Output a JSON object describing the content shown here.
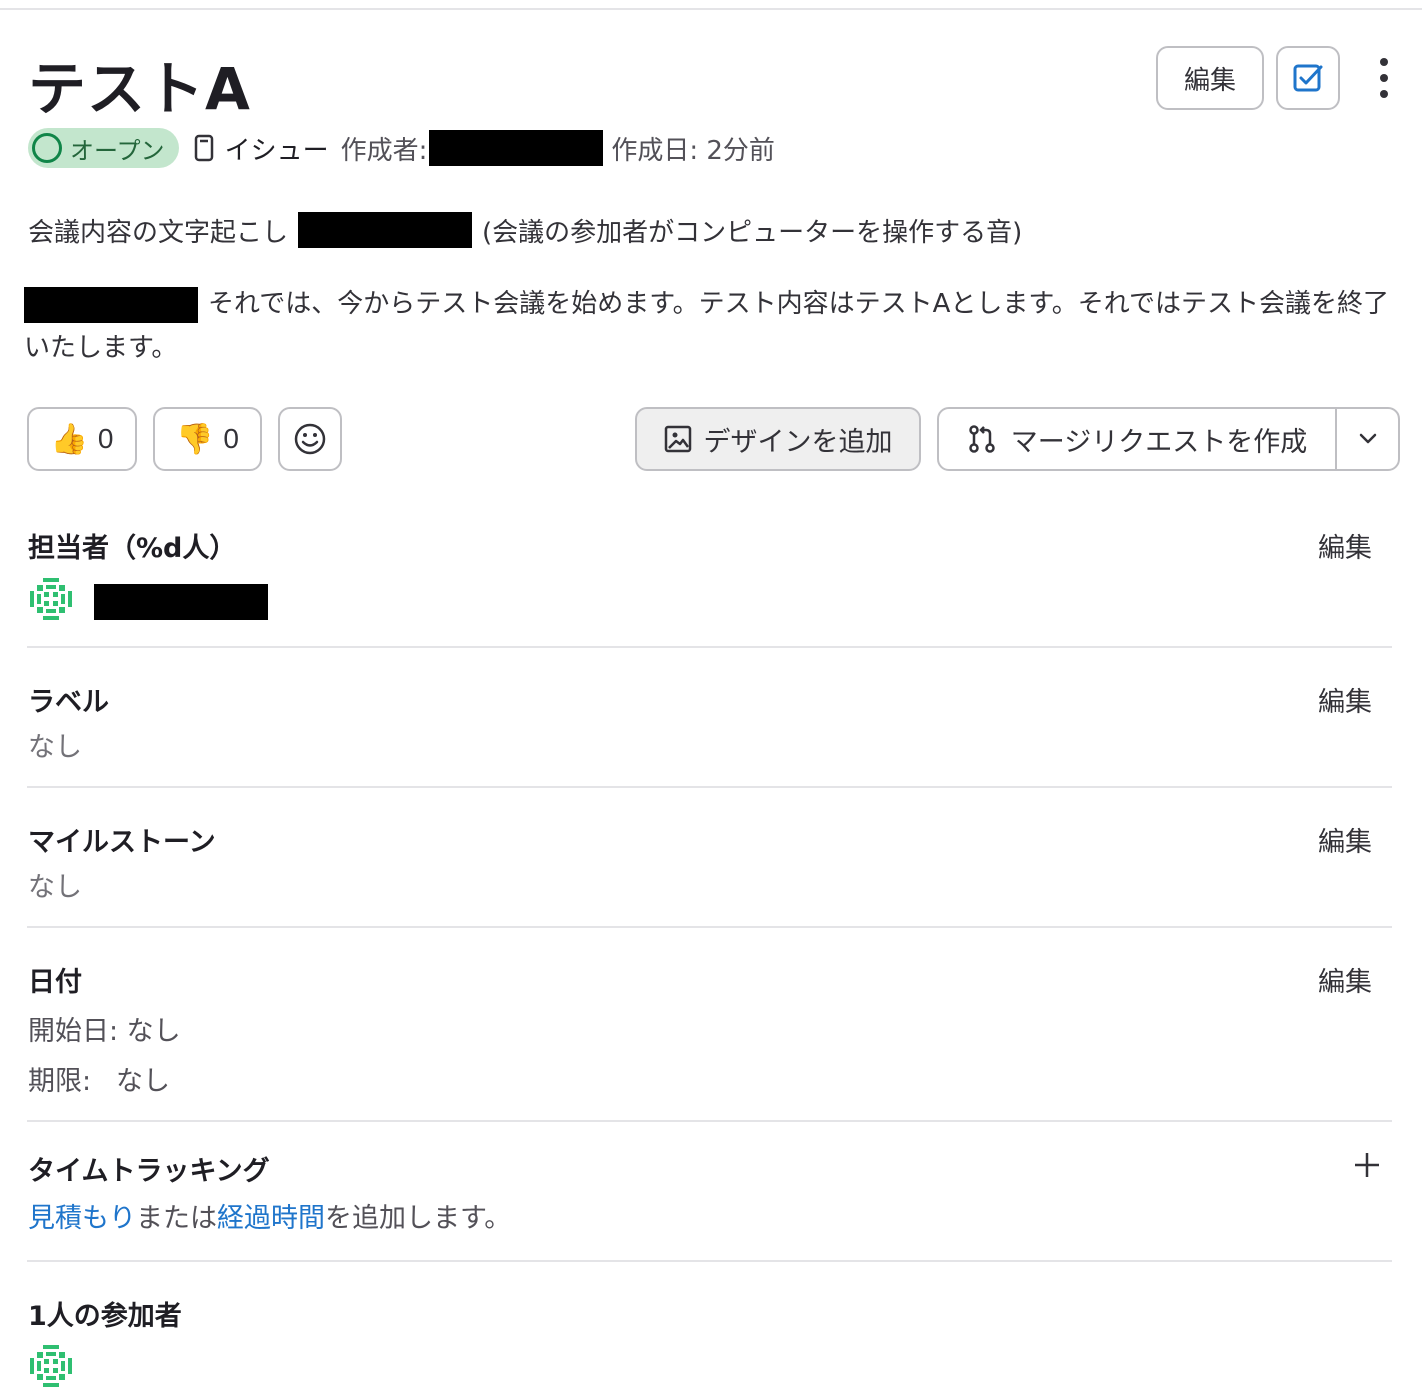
{
  "issue": {
    "title": "テストA",
    "status": "オープン",
    "type": "イシュー",
    "author_label": "作成者:",
    "created_label": "作成日: 2分前"
  },
  "header_actions": {
    "edit_label": "編集"
  },
  "description": {
    "line1_before": "会議内容の文字起こし",
    "line1_after": "(会議の参加者がコンピューターを操作する音)",
    "paragraph": "それでは、今からテスト会議を始めます。テスト内容はテストAとします。それではテスト会議を終了いたします。"
  },
  "reactions": {
    "thumbs_up_count": "0",
    "thumbs_down_count": "0"
  },
  "actions": {
    "add_design": "デザインを追加",
    "create_mr": "マージリクエストを作成"
  },
  "sidebar": {
    "assignees": {
      "title": "担当者（%d人）",
      "edit": "編集"
    },
    "labels": {
      "title": "ラベル",
      "value": "なし",
      "edit": "編集"
    },
    "milestone": {
      "title": "マイルストーン",
      "value": "なし",
      "edit": "編集"
    },
    "dates": {
      "title": "日付",
      "start": "開始日: なし",
      "due_label": "期限:",
      "due_value": "なし",
      "edit": "編集"
    },
    "time_tracking": {
      "title": "タイムトラッキング",
      "estimate_link": "見積もり",
      "middle": "または",
      "spent_link": "経過時間",
      "suffix": "を追加します。"
    },
    "participants": {
      "title": "1人の参加者"
    }
  },
  "colors": {
    "status_bg": "#c3e6cd",
    "status_fg": "#108548",
    "link": "#1f75cb",
    "avatar": "#2fbf71"
  }
}
